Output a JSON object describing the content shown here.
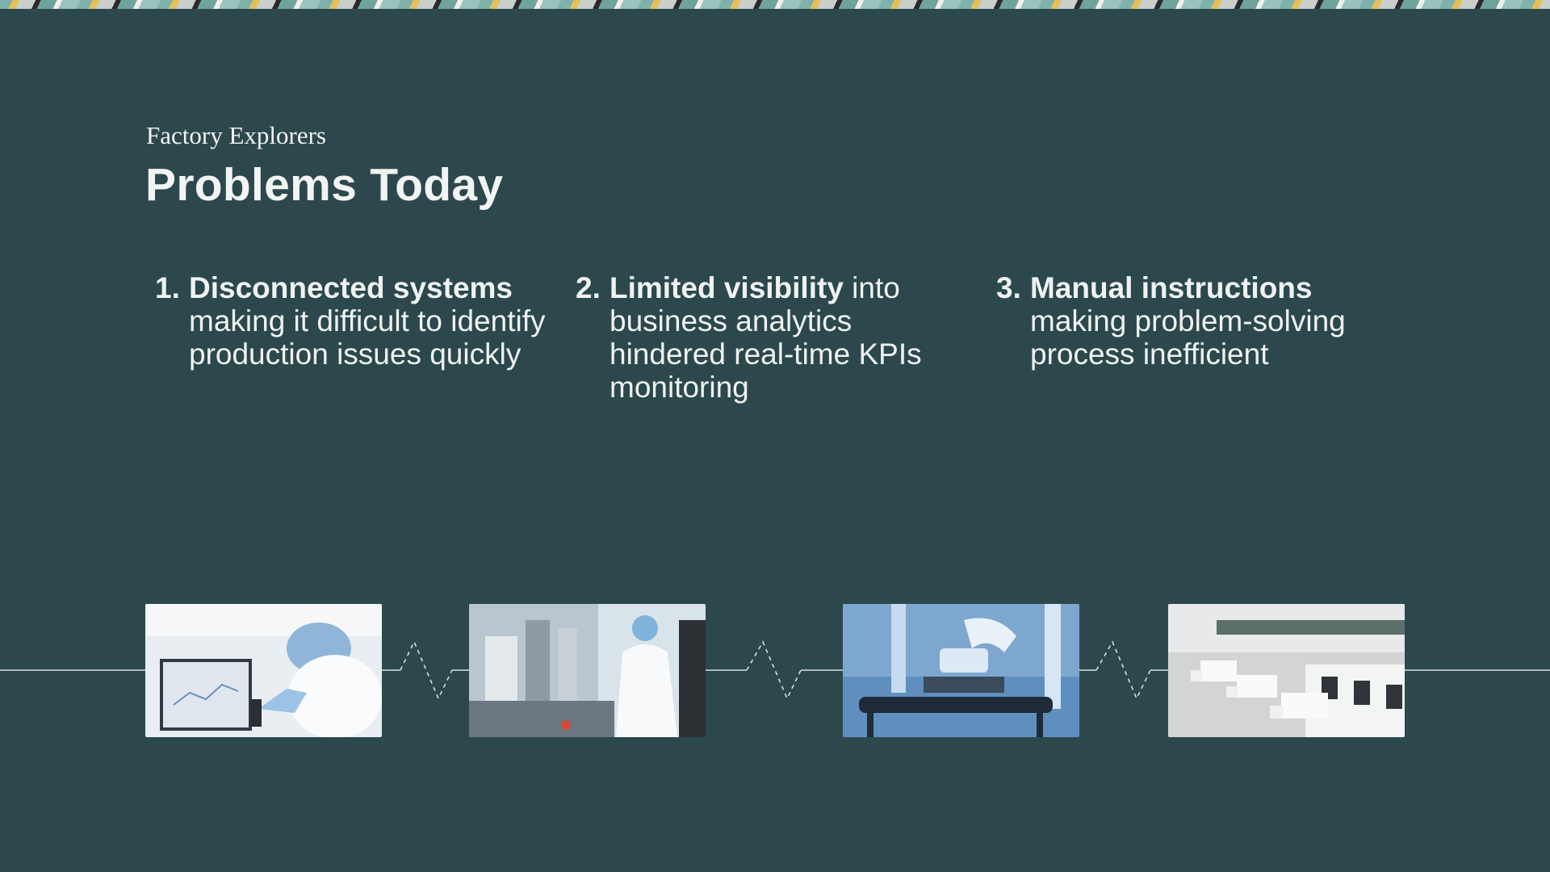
{
  "slide": {
    "subtitle": "Factory Explorers",
    "title": "Problems Today"
  },
  "problems": [
    {
      "number": "1.",
      "bold": "Disconnected systems",
      "rest": "making it difficult to identify production issues quickly",
      "inline_rest": ""
    },
    {
      "number": "2.",
      "bold": "Limited visibility",
      "inline_rest": " into",
      "rest": "business analytics hindered real-time KPIs monitoring"
    },
    {
      "number": "3.",
      "bold": "Manual instructions",
      "rest": "making problem-solving process inefficient",
      "inline_rest": ""
    }
  ],
  "photos": [
    {
      "icon": "lab-worker-monitor-photo"
    },
    {
      "icon": "cleanroom-technician-photo"
    },
    {
      "icon": "robotic-arm-conveyor-photo"
    },
    {
      "icon": "delivery-trucks-warehouse-photo"
    }
  ],
  "colors": {
    "background": "#2c484c",
    "text": "#eef2f1",
    "line": "#d7e0de"
  }
}
